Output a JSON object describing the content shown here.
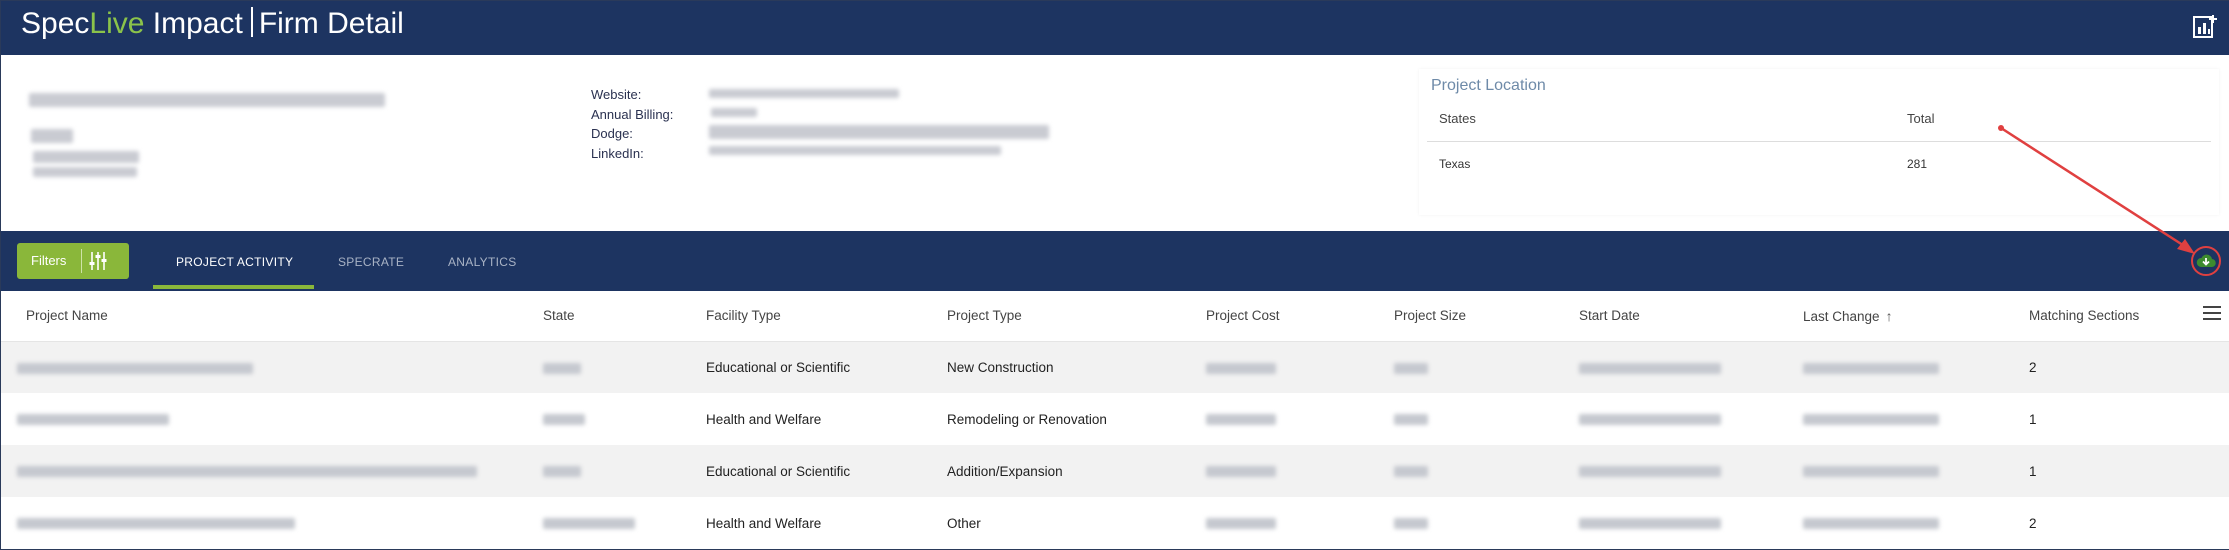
{
  "app": {
    "brand_spec": "Spec",
    "brand_live": "Live",
    "brand_impact": " Impact",
    "page_title": "Firm Detail",
    "report_icon": "chart-add-icon"
  },
  "firm_info": {
    "website_label": "Website:",
    "billing_label": "Annual Billing:",
    "dodge_label": "Dodge:",
    "linkedin_label": "LinkedIn:"
  },
  "project_location": {
    "title": "Project Location",
    "col_states": "States",
    "col_total": "Total",
    "rows": [
      {
        "state": "Texas",
        "total": "281"
      }
    ]
  },
  "toolbar": {
    "filters_label": "Filters",
    "tabs": [
      "PROJECT ACTIVITY",
      "SPECRATE",
      "ANALYTICS"
    ],
    "active_tab": "PROJECT ACTIVITY",
    "download_icon": "cloud-download-icon"
  },
  "table": {
    "columns": [
      "Project Name",
      "State",
      "Facility Type",
      "Project Type",
      "Project Cost",
      "Project Size",
      "Start Date",
      "Last Change",
      "Matching Sections"
    ],
    "sorted_column": "Last Change",
    "sort_direction": "ascending",
    "rows": [
      {
        "facility_type": "Educational or Scientific",
        "project_type": "New Construction",
        "matching_sections": "2"
      },
      {
        "facility_type": "Health and Welfare",
        "project_type": "Remodeling or Renovation",
        "matching_sections": "1"
      },
      {
        "facility_type": "Educational or Scientific",
        "project_type": "Addition/Expansion",
        "matching_sections": "1"
      },
      {
        "facility_type": "Health and Welfare",
        "project_type": "Other",
        "matching_sections": "2"
      }
    ]
  },
  "colors": {
    "navy": "#1d3461",
    "accent_green": "#8ab73a",
    "annotation_red": "#e04040"
  }
}
